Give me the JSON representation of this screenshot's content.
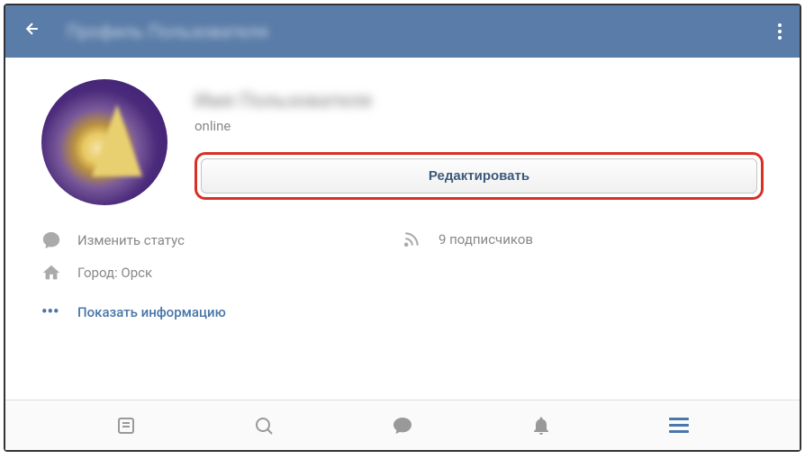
{
  "header": {
    "title": "Профиль Пользователя"
  },
  "profile": {
    "username": "Имя Пользователя",
    "status": "online",
    "edit_button": "Редактировать"
  },
  "info": {
    "change_status": "Изменить статус",
    "city": "Город: Орск",
    "followers": "9 подписчиков",
    "show_more": "Показать информацию"
  }
}
